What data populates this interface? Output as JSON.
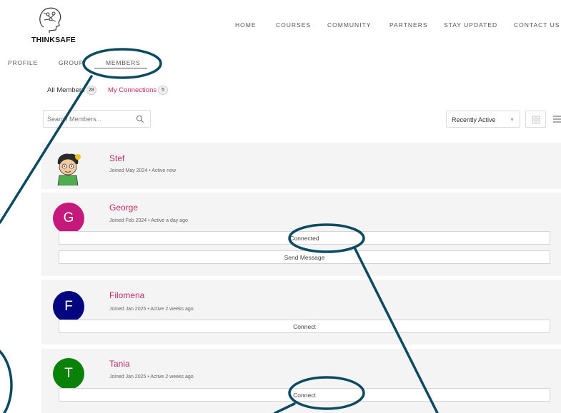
{
  "logo": {
    "text": "THINKSAFE"
  },
  "topnav": {
    "items": [
      "HOME",
      "COURSES",
      "COMMUNITY",
      "PARTNERS",
      "STAY UPDATED",
      "CONTACT US"
    ]
  },
  "subnav": {
    "profile": "PROFILE",
    "groups": "GROUP",
    "members": "MEMBERS"
  },
  "filters": {
    "all_members_label": "All Members",
    "all_members_count": "28",
    "my_connections_label": "My Connections",
    "my_connections_count": "5"
  },
  "search": {
    "placeholder": "Search Members..."
  },
  "sort": {
    "selected": "Recently Active"
  },
  "colors": {
    "accent": "#c02a67",
    "annotation": "#0c4a60"
  },
  "members": [
    {
      "name": "Stef",
      "meta": "Joined May 2024 • Active now",
      "avatar": "cartoon"
    },
    {
      "name": "George",
      "meta": "Joined Feb 2024 • Active a day ago",
      "initial": "G",
      "avatar_color": "#c51a7c",
      "actions": [
        "Connected",
        "Send Message"
      ]
    },
    {
      "name": "Filomena",
      "meta": "Joined Jan 2025 • Active 2 weeks ago",
      "initial": "F",
      "avatar_color": "#050580",
      "actions": [
        "Connect"
      ]
    },
    {
      "name": "Tania",
      "meta": "Joined Jan 2025 • Active 2 weeks ago",
      "initial": "T",
      "avatar_color": "#0a820a",
      "actions": [
        "Connect"
      ]
    }
  ]
}
